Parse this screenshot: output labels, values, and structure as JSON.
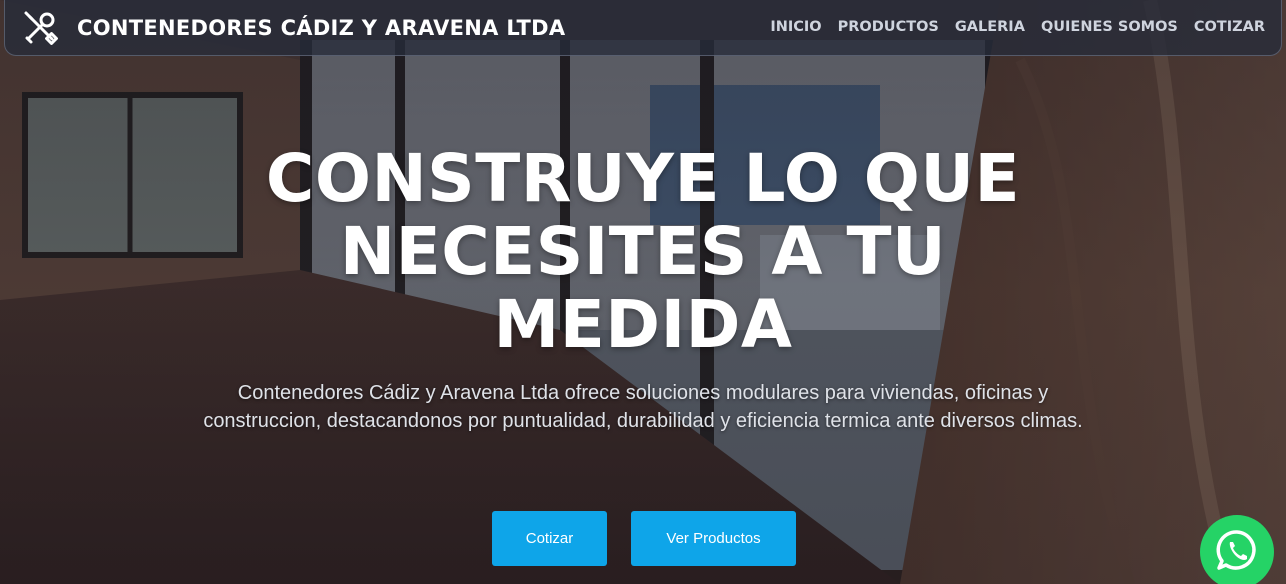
{
  "navbar": {
    "brand_icon": "tools-icon",
    "brand_name": "CONTENEDORES CÁDIZ Y ARAVENA LTDA",
    "links": [
      {
        "label": "INICIO"
      },
      {
        "label": "PRODUCTOS"
      },
      {
        "label": "GALERIA"
      },
      {
        "label": "QUIENES SOMOS"
      },
      {
        "label": "COTIZAR"
      }
    ]
  },
  "hero": {
    "headline": "CONSTRUYE LO QUE NECESITES A TU MEDIDA",
    "subtitle": "Contenedores Cádiz y Aravena Ltda ofrece soluciones modulares para viviendas, oficinas y construccion, destacandonos por puntualidad, durabilidad y eficiencia termica ante diversos climas.",
    "buttons": {
      "cotizar": "Cotizar",
      "ver_productos": "Ver Productos"
    }
  },
  "floating": {
    "whatsapp_icon": "whatsapp-icon"
  },
  "colors": {
    "accent": "#0ea5e9",
    "whatsapp": "#25d366",
    "nav_bg": "#262c3a"
  }
}
